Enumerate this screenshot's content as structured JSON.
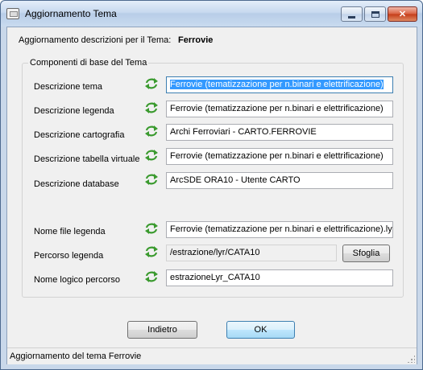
{
  "window": {
    "title": "Aggiornamento Tema",
    "controls": {
      "minimize": "minimize-icon",
      "maximize": "maximize-icon",
      "close": "close-icon"
    }
  },
  "header": {
    "label": "Aggiornamento descrizioni per il Tema:",
    "theme_name": "Ferrovie"
  },
  "group": {
    "legend": "Componenti di base del Tema",
    "rows": [
      {
        "label": "Descrizione tema",
        "value": "Ferrovie (tematizzazione per n.binari e elettrificazione)",
        "selected": true
      },
      {
        "label": "Descrizione legenda",
        "value": "Ferrovie (tematizzazione per n.binari e elettrificazione)"
      },
      {
        "label": "Descrizione cartografia",
        "value": "Archi Ferroviari - CARTO.FERROVIE"
      },
      {
        "label": "Descrizione tabella virtuale",
        "value": "Ferrovie (tematizzazione per n.binari e elettrificazione)"
      },
      {
        "label": "Descrizione database",
        "value": "ArcSDE ORA10 - Utente CARTO"
      },
      {
        "label": "Nome file legenda",
        "value": "Ferrovie (tematizzazione per n.binari e elettrificazione).lyr"
      },
      {
        "label": "Percorso legenda",
        "value": "/estrazione/lyr/CATA10",
        "readonly": true
      },
      {
        "label": "Nome logico percorso",
        "value": "estrazioneLyr_CATA10"
      }
    ],
    "browse_button": "Sfoglia"
  },
  "buttons": {
    "back": "Indietro",
    "ok": "OK"
  },
  "status": {
    "text": "Aggiornamento del tema Ferrovie"
  },
  "colors": {
    "refresh_icon": "#3a9a2e",
    "selection": "#3399ff"
  }
}
